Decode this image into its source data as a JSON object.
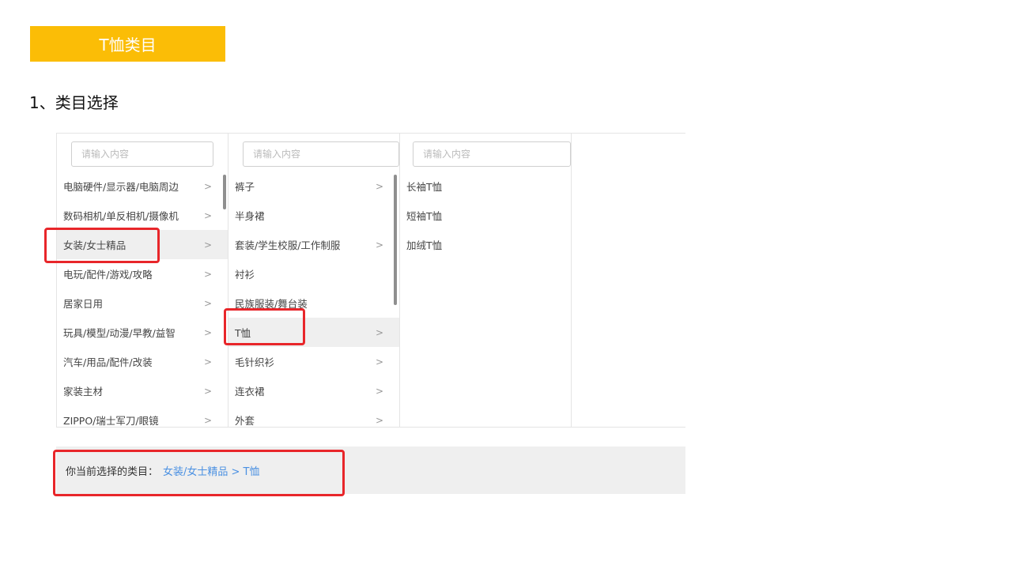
{
  "banner": {
    "title": "T恤类目"
  },
  "section": {
    "title": "1、类目选择"
  },
  "columns": [
    {
      "placeholder": "请输入内容",
      "items": [
        {
          "label": "电脑硬件/显示器/电脑周边",
          "arrow": ">"
        },
        {
          "label": "数码相机/单反相机/摄像机",
          "arrow": ">"
        },
        {
          "label": "女装/女士精品",
          "arrow": ">",
          "selected": true
        },
        {
          "label": "电玩/配件/游戏/攻略",
          "arrow": ">"
        },
        {
          "label": "居家日用",
          "arrow": ">"
        },
        {
          "label": "玩具/模型/动漫/早教/益智",
          "arrow": ">"
        },
        {
          "label": "汽车/用品/配件/改装",
          "arrow": ">"
        },
        {
          "label": "家装主材",
          "arrow": ">"
        },
        {
          "label": "ZIPPO/瑞士军刀/眼镜",
          "arrow": ">"
        }
      ]
    },
    {
      "placeholder": "请输入内容",
      "items": [
        {
          "label": "裤子",
          "arrow": ">"
        },
        {
          "label": "半身裙",
          "arrow": ""
        },
        {
          "label": "套装/学生校服/工作制服",
          "arrow": ">"
        },
        {
          "label": "衬衫",
          "arrow": ""
        },
        {
          "label": "民族服装/舞台装",
          "arrow": ""
        },
        {
          "label": "T恤",
          "arrow": ">",
          "selected": true
        },
        {
          "label": "毛针织衫",
          "arrow": ">"
        },
        {
          "label": "连衣裙",
          "arrow": ">"
        },
        {
          "label": "外套",
          "arrow": ">"
        }
      ]
    },
    {
      "placeholder": "请输入内容",
      "items": [
        {
          "label": "长袖T恤",
          "arrow": ""
        },
        {
          "label": "短袖T恤",
          "arrow": ""
        },
        {
          "label": "加绒T恤",
          "arrow": ""
        }
      ]
    }
  ],
  "selection": {
    "label": "你当前选择的类目：",
    "value": "女装/女士精品 > T恤"
  },
  "colors": {
    "banner": "#fbbd06",
    "highlight": "#e8262a",
    "link": "#4a90e2"
  }
}
